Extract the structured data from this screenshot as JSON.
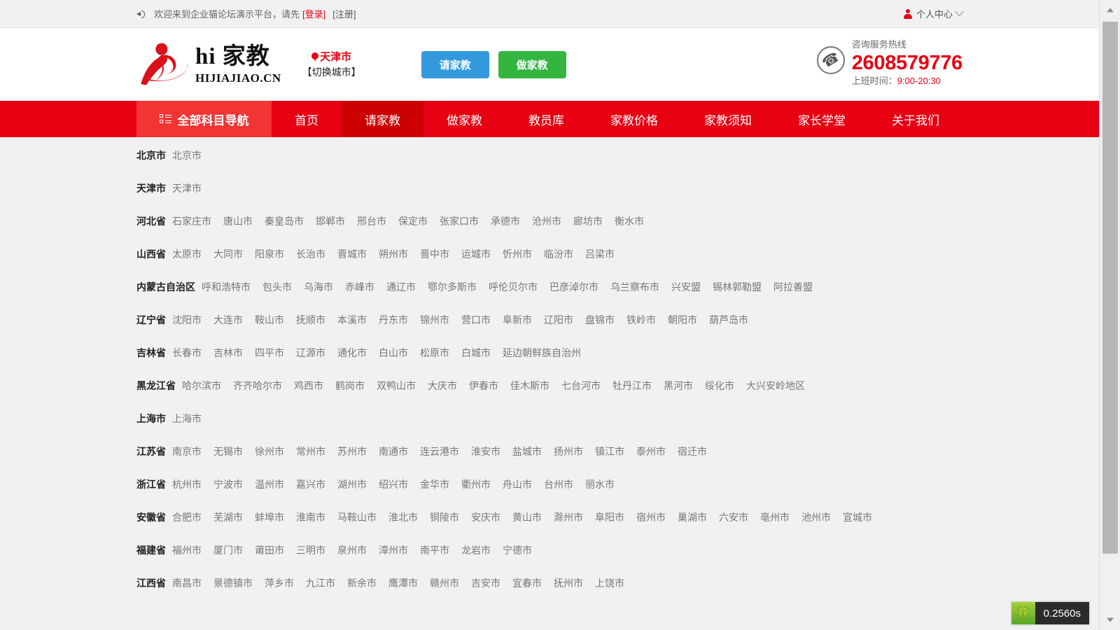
{
  "topbar": {
    "speaker_icon": "speaker-icon",
    "welcome": "欢迎来到企业猫论坛演示平台，请先",
    "login": "[登录]",
    "register": "[注册]",
    "user_icon": "user-icon",
    "user_center": "个人中心",
    "caret_icon": "chevron-down-icon"
  },
  "header": {
    "logo_hi": "hi 家教",
    "logo_domain": "HIJIAJIAO.CN",
    "pin_icon": "map-pin-icon",
    "current_city": "天津市",
    "switch_city": "【切换城市】",
    "btn_request": "请家教",
    "btn_become": "做家教",
    "phone_icon": "phone-icon",
    "hotline_label": "咨询服务热线",
    "hotline_number": "2608579776",
    "hours_label": "上班时间：",
    "hours_value": "9:00-20:30"
  },
  "nav": {
    "all_subjects_icon": "grid-list-icon",
    "all_subjects": "全部科目导航",
    "items": [
      {
        "label": "首页",
        "active": false
      },
      {
        "label": "请家教",
        "active": true
      },
      {
        "label": "做家教",
        "active": false
      },
      {
        "label": "教员库",
        "active": false
      },
      {
        "label": "家教价格",
        "active": false
      },
      {
        "label": "家教须知",
        "active": false
      },
      {
        "label": "家长学堂",
        "active": false
      },
      {
        "label": "关于我们",
        "active": false
      }
    ]
  },
  "provinces": [
    {
      "name": "北京市",
      "cities": [
        "北京市"
      ]
    },
    {
      "name": "天津市",
      "cities": [
        "天津市"
      ]
    },
    {
      "name": "河北省",
      "cities": [
        "石家庄市",
        "唐山市",
        "秦皇岛市",
        "邯郸市",
        "邢台市",
        "保定市",
        "张家口市",
        "承德市",
        "沧州市",
        "廊坊市",
        "衡水市"
      ]
    },
    {
      "name": "山西省",
      "cities": [
        "太原市",
        "大同市",
        "阳泉市",
        "长治市",
        "晋城市",
        "朔州市",
        "晋中市",
        "运城市",
        "忻州市",
        "临汾市",
        "吕梁市"
      ]
    },
    {
      "name": "内蒙古自治区",
      "cities": [
        "呼和浩特市",
        "包头市",
        "乌海市",
        "赤峰市",
        "通辽市",
        "鄂尔多斯市",
        "呼伦贝尔市",
        "巴彦淖尔市",
        "乌兰察布市",
        "兴安盟",
        "锡林郭勒盟",
        "阿拉善盟"
      ]
    },
    {
      "name": "辽宁省",
      "cities": [
        "沈阳市",
        "大连市",
        "鞍山市",
        "抚顺市",
        "本溪市",
        "丹东市",
        "锦州市",
        "营口市",
        "阜新市",
        "辽阳市",
        "盘锦市",
        "铁岭市",
        "朝阳市",
        "葫芦岛市"
      ]
    },
    {
      "name": "吉林省",
      "cities": [
        "长春市",
        "吉林市",
        "四平市",
        "辽源市",
        "通化市",
        "白山市",
        "松原市",
        "白城市",
        "延边朝鲜族自治州"
      ]
    },
    {
      "name": "黑龙江省",
      "cities": [
        "哈尔滨市",
        "齐齐哈尔市",
        "鸡西市",
        "鹤岗市",
        "双鸭山市",
        "大庆市",
        "伊春市",
        "佳木斯市",
        "七台河市",
        "牡丹江市",
        "黑河市",
        "绥化市",
        "大兴安岭地区"
      ]
    },
    {
      "name": "上海市",
      "cities": [
        "上海市"
      ]
    },
    {
      "name": "江苏省",
      "cities": [
        "南京市",
        "无锡市",
        "徐州市",
        "常州市",
        "苏州市",
        "南通市",
        "连云港市",
        "淮安市",
        "盐城市",
        "扬州市",
        "镇江市",
        "泰州市",
        "宿迁市"
      ]
    },
    {
      "name": "浙江省",
      "cities": [
        "杭州市",
        "宁波市",
        "温州市",
        "嘉兴市",
        "湖州市",
        "绍兴市",
        "金华市",
        "衢州市",
        "舟山市",
        "台州市",
        "丽水市"
      ]
    },
    {
      "name": "安徽省",
      "cities": [
        "合肥市",
        "芜湖市",
        "蚌埠市",
        "淮南市",
        "马鞍山市",
        "淮北市",
        "铜陵市",
        "安庆市",
        "黄山市",
        "滁州市",
        "阜阳市",
        "宿州市",
        "巢湖市",
        "六安市",
        "亳州市",
        "池州市",
        "宣城市"
      ]
    },
    {
      "name": "福建省",
      "cities": [
        "福州市",
        "厦门市",
        "莆田市",
        "三明市",
        "泉州市",
        "漳州市",
        "南平市",
        "龙岩市",
        "宁德市"
      ]
    },
    {
      "name": "江西省",
      "cities": [
        "南昌市",
        "景德镇市",
        "萍乡市",
        "九江市",
        "新余市",
        "鹰潭市",
        "赣州市",
        "吉安市",
        "宜春市",
        "抚州市",
        "上饶市"
      ]
    }
  ],
  "perf": {
    "icon": "flame-icon",
    "time": "0.2560s"
  },
  "colors": {
    "brand_red": "#e60012",
    "nav_red": "#e60012",
    "nav_active_red": "#cc0000",
    "nav_all_red": "#f23434",
    "btn_blue": "#3399dd",
    "btn_green": "#33b540",
    "page_bg": "#f1f1f1"
  }
}
